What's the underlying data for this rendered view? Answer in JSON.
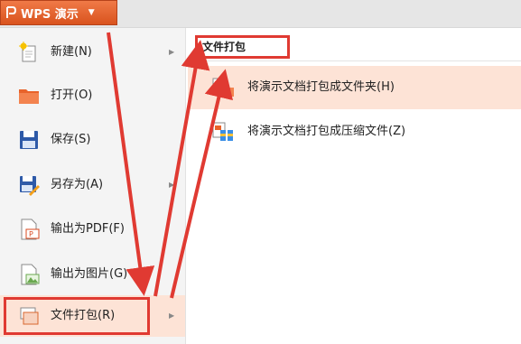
{
  "app": {
    "title": "WPS 演示",
    "accent": "#e8632b"
  },
  "left_menu": {
    "items": [
      {
        "label": "新建(N)",
        "icon": "new-document-icon",
        "has_submenu": true
      },
      {
        "label": "打开(O)",
        "icon": "folder-icon",
        "has_submenu": false
      },
      {
        "label": "保存(S)",
        "icon": "save-icon",
        "has_submenu": false
      },
      {
        "label": "另存为(A)",
        "icon": "save-as-icon",
        "has_submenu": true
      },
      {
        "label": "输出为PDF(F)",
        "icon": "pdf-icon",
        "has_submenu": false
      },
      {
        "label": "输出为图片(G)",
        "icon": "image-icon",
        "has_submenu": false
      },
      {
        "label": "文件打包(R)",
        "icon": "package-icon",
        "has_submenu": true,
        "active": true
      }
    ]
  },
  "submenu": {
    "header": "文件打包",
    "items": [
      {
        "label": "将演示文档打包成文件夹(H)",
        "icon": "package-folder-icon",
        "active": true
      },
      {
        "label": "将演示文档打包成压缩文件(Z)",
        "icon": "package-zip-icon",
        "active": false
      }
    ]
  },
  "colors": {
    "highlight": "#fde3d6",
    "annotation": "#e03a32"
  }
}
